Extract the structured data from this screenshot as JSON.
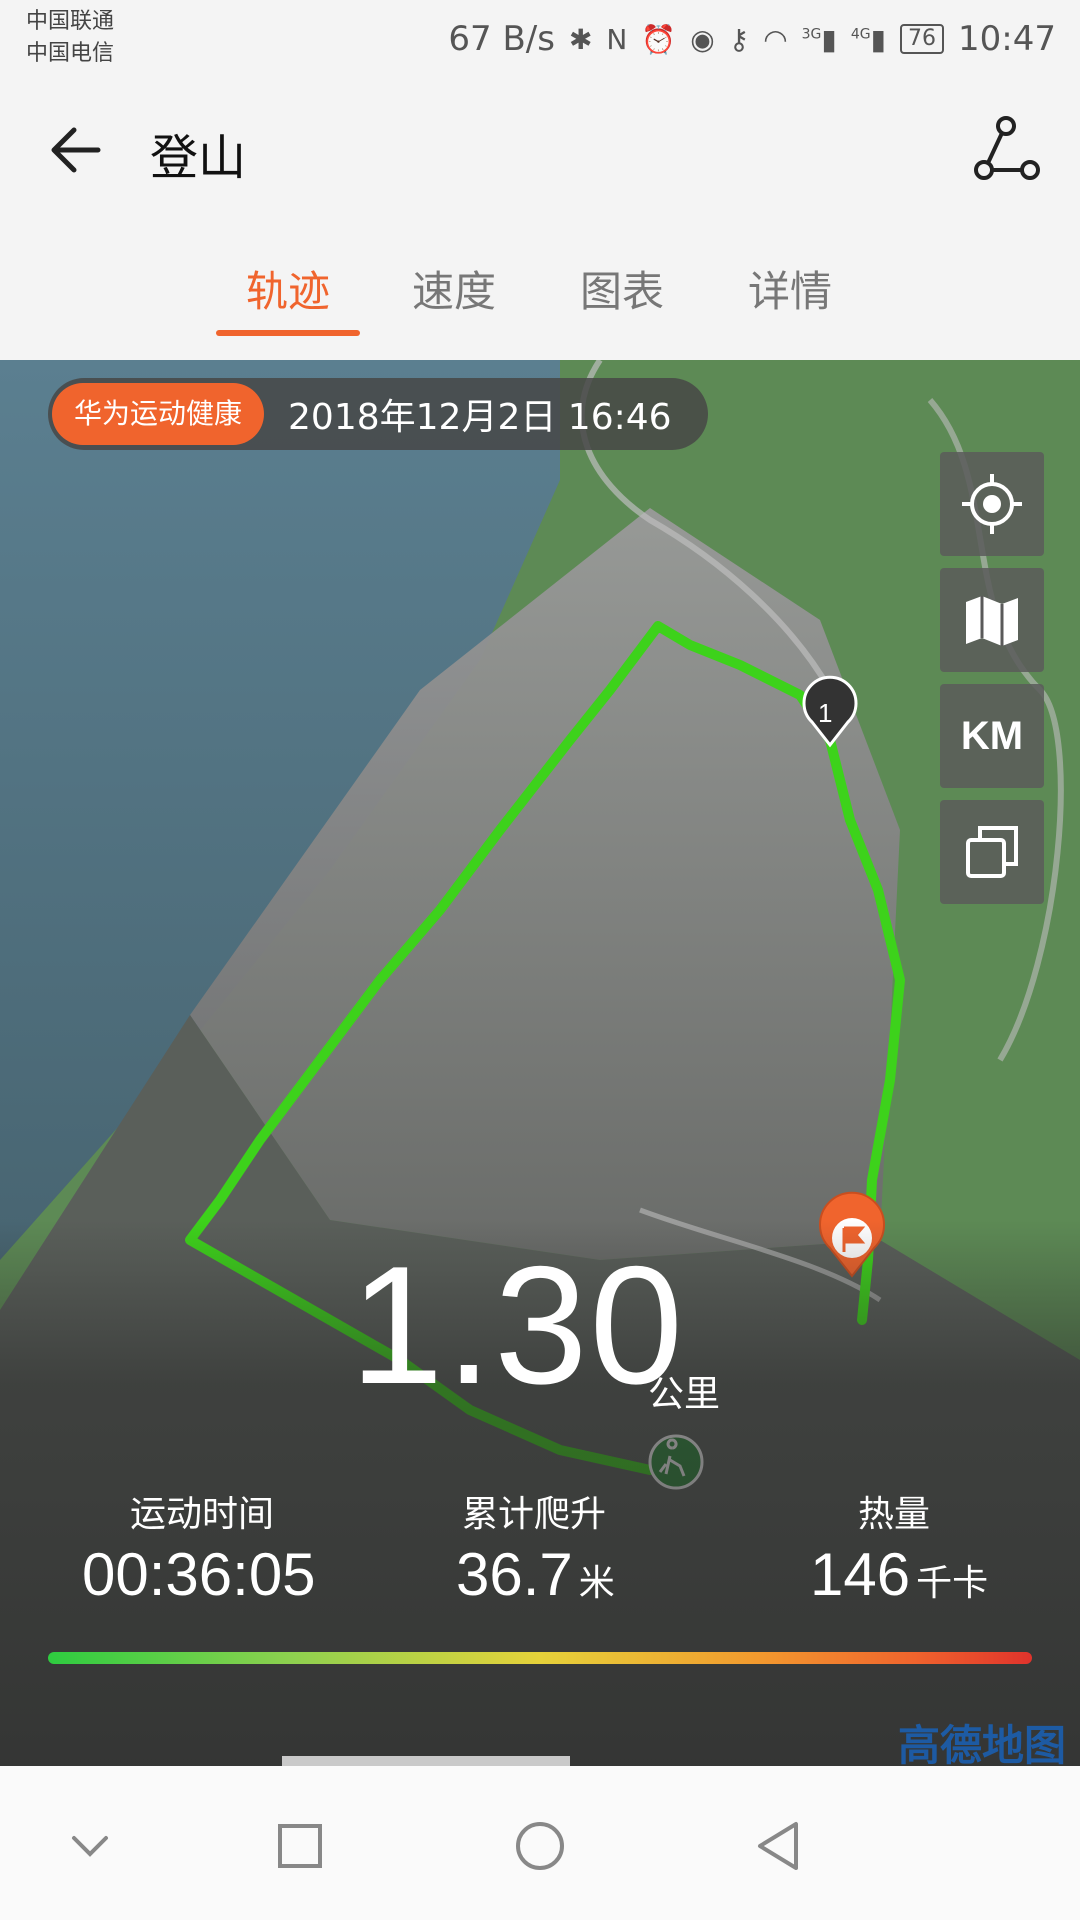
{
  "status_bar": {
    "carrier_1": "中国联通",
    "carrier_2": "中国电信",
    "net_speed": "67 B/s",
    "net_3g": "3G",
    "net_4g": "4G",
    "battery": "76",
    "time": "10:47"
  },
  "header": {
    "title": "登山"
  },
  "tabs": [
    {
      "label": "轨迹",
      "active": true
    },
    {
      "label": "速度",
      "active": false
    },
    {
      "label": "图表",
      "active": false
    },
    {
      "label": "详情",
      "active": false
    }
  ],
  "map": {
    "brand_label": "华为运动健康",
    "datetime": "2018年12月2日 16:46",
    "km_label": "KM",
    "marker_label": "1",
    "provider_logo": "高德地图",
    "track_color": "#3dd21b"
  },
  "summary": {
    "distance": "1.30",
    "distance_unit": "公里",
    "stats": [
      {
        "label": "运动时间",
        "value": "00:36:05",
        "unit": ""
      },
      {
        "label": "累计爬升",
        "value": "36.7",
        "unit": "米"
      },
      {
        "label": "热量",
        "value": "146",
        "unit": "千卡"
      }
    ]
  },
  "colors": {
    "accent": "#f0642d"
  },
  "icons": [
    "back-arrow-icon",
    "route-icon",
    "locate-icon",
    "map-icon",
    "layers-icon",
    "flag-icon",
    "hiker-icon",
    "nav-back-icon",
    "nav-home-icon",
    "nav-recents-icon",
    "nav-hide-icon"
  ]
}
